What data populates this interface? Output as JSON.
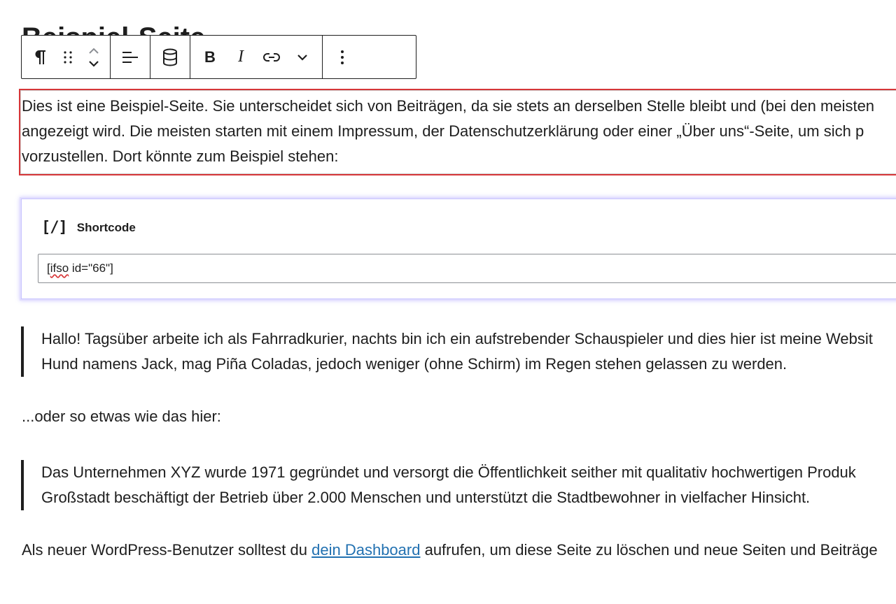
{
  "page": {
    "title": "Beispiel-Seite"
  },
  "toolbar": {
    "paragraph_icon": "pilcrow-icon",
    "drag_icon": "drag-handle-icon",
    "move_up_icon": "chevron-up-icon",
    "move_down_icon": "chevron-down-icon",
    "align_icon": "align-left-icon",
    "database_icon": "database-icon",
    "bold_label": "B",
    "italic_label": "I",
    "link_icon": "link-icon",
    "more_formats_icon": "chevron-down-icon",
    "options_icon": "more-vertical-icon"
  },
  "selected_paragraph": {
    "lines": [
      "Dies ist eine Beispiel-Seite. Sie unterscheidet sich von Beiträgen, da sie stets an derselben Stelle bleibt und (bei den meisten",
      "angezeigt wird. Die meisten starten mit einem Impressum, der Datenschutzerklärung oder einer „Über uns“-Seite, um sich p",
      "vorzustellen. Dort könnte zum Beispiel stehen:"
    ]
  },
  "shortcode": {
    "icon": "[/]",
    "label": "Shortcode",
    "value_misspelled": "ifso",
    "value_prefix": "[",
    "value_suffix": " id=\"66\"]"
  },
  "quote1": {
    "lines": [
      "Hallo! Tagsüber arbeite ich als Fahrradkurier, nachts bin ich ein aufstrebender Schauspieler und dies hier ist meine Websit",
      "Hund namens Jack, mag Piña Coladas, jedoch weniger (ohne Schirm) im Regen stehen gelassen zu werden."
    ]
  },
  "middle_paragraph": "...oder so etwas wie das hier:",
  "quote2": {
    "lines": [
      "Das Unternehmen XYZ wurde 1971 gegründet und versorgt die Öffentlichkeit seither mit qualitativ hochwertigen Produk",
      "Großstadt beschäftigt der Betrieb über 2.000 Menschen und unterstützt die Stadtbewohner in vielfacher Hinsicht."
    ]
  },
  "final_paragraph": {
    "before": "Als neuer WordPress-Benutzer solltest du ",
    "link": "dein Dashboard",
    "after": " aufrufen, um diese Seite zu löschen und neue Seiten und Beiträge"
  }
}
